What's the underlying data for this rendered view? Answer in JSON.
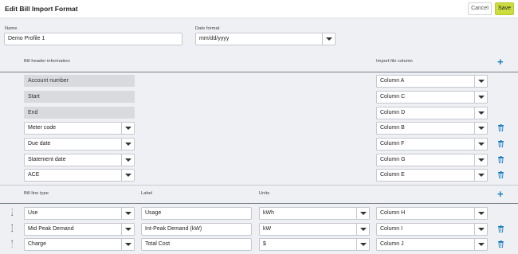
{
  "header": {
    "title": "Edit Bill Import Format",
    "cancel_label": "Cancel",
    "save_label": "Save"
  },
  "profile": {
    "name_label": "Name",
    "name_value": "Demo Profile 1",
    "date_format_label": "Date format",
    "date_format_value": "mm/dd/yyyy"
  },
  "bill_header": {
    "header_label": "Bill header information",
    "column_header_label": "Import file column",
    "readonly_rows": [
      {
        "field": "Account number",
        "column": "Column A"
      },
      {
        "field": "Start",
        "column": "Column C"
      },
      {
        "field": "End",
        "column": "Column D"
      }
    ],
    "editable_rows": [
      {
        "field": "Meter code",
        "column": "Column B"
      },
      {
        "field": "Due date",
        "column": "Column F"
      },
      {
        "field": "Statement date",
        "column": "Column G"
      },
      {
        "field": "ACE",
        "column": "Column E"
      }
    ]
  },
  "bill_lines": {
    "type_header": "Bill line type",
    "label_header": "Label",
    "units_header": "Units",
    "rows": [
      {
        "type": "Use",
        "label": "Usage",
        "units": "kWh",
        "column": "Column H"
      },
      {
        "type": "Mid Peak Demand",
        "label": "Int-Peak Demand (kW)",
        "units": "kW",
        "column": "Column I"
      },
      {
        "type": "Charge",
        "label": "Total Cost",
        "units": "$",
        "column": "Column J"
      }
    ]
  },
  "icons": {
    "add": "plus-icon",
    "delete": "trash-icon",
    "reorder": "up-down-arrows-icon",
    "dropdown": "chevron-down-icon"
  },
  "colors": {
    "accent": "#1a7fc2",
    "save_button": "#cbdc3e",
    "readonly_bg": "#d8dade",
    "page_bg": "#eef0f4"
  }
}
